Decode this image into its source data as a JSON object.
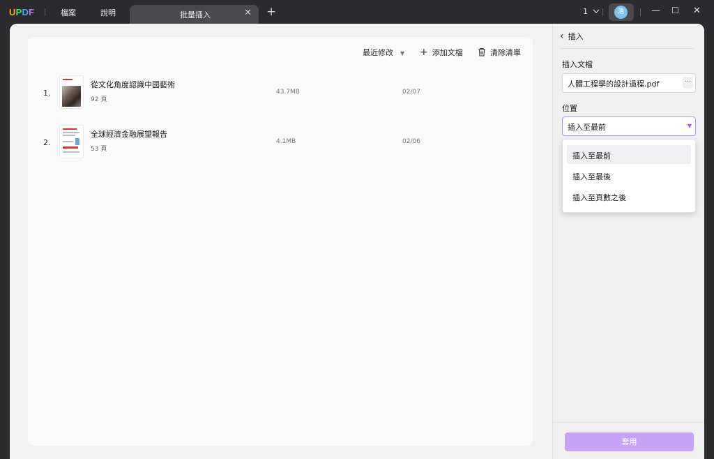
{
  "app": {
    "logo_letters": [
      "U",
      "P",
      "D",
      "F"
    ],
    "menu": [
      "檔案",
      "說明"
    ],
    "tab_title": "批量插入",
    "tab_close": "✕",
    "new_tab": "+",
    "page_count": "1",
    "avatar_initial": "浩"
  },
  "window_controls": {
    "minimize": "—",
    "maximize": "☐",
    "close": "✕"
  },
  "toolbar": {
    "sort_label": "最近修改",
    "add_label": "添加文檔",
    "clear_label": "清除清單"
  },
  "files": [
    {
      "num": "1.",
      "title": "從文化角度認識中國藝術",
      "pages": "92 頁",
      "size": "43.7MB",
      "date": "02/07"
    },
    {
      "num": "2.",
      "title": "全球經濟金融展望報告",
      "pages": "53 頁",
      "size": "4.1MB",
      "date": "02/06"
    }
  ],
  "side": {
    "header": "插入",
    "back_icon": "‹",
    "insert_doc_label": "插入文檔",
    "insert_doc_value": "人體工程學的設計過程.pdf",
    "more_button": "···",
    "position_label": "位置",
    "position_value": "插入至最前",
    "options": [
      "插入至最前",
      "插入至最後",
      "插入至頁數之後"
    ],
    "apply_label": "套用"
  },
  "colors": {
    "accent": "#9b5de5",
    "apply_button": "#c8a2f5",
    "titlebar": "#2b2b2e"
  }
}
